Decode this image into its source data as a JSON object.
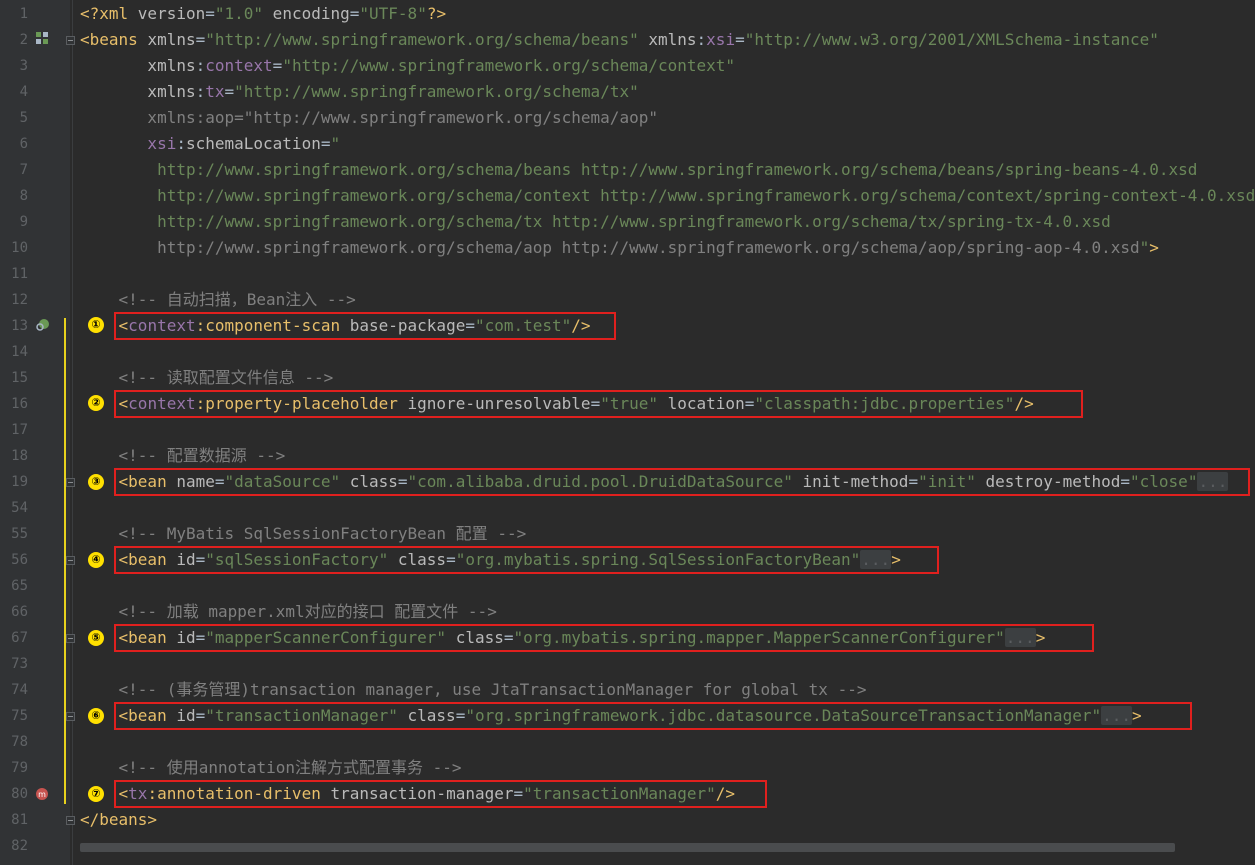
{
  "editor": {
    "lines": [
      {
        "n": "1",
        "parts": [
          [
            "tag",
            "<?xml "
          ],
          [
            "attr",
            "version"
          ],
          [
            "",
            "="
          ],
          [
            "val",
            "\"1.0\""
          ],
          [
            "attr",
            " encoding"
          ],
          [
            "",
            "="
          ],
          [
            "val",
            "\"UTF-8\""
          ],
          [
            "tag",
            "?>"
          ]
        ]
      },
      {
        "n": "2",
        "parts": [
          [
            "tag",
            "<beans "
          ],
          [
            "attr",
            "xmlns"
          ],
          [
            "",
            "="
          ],
          [
            "val",
            "\"http://www.springframework.org/schema/beans\""
          ],
          [
            "attr",
            " xmlns"
          ],
          [
            "",
            ":"
          ],
          [
            "ns",
            "xsi"
          ],
          [
            "",
            "="
          ],
          [
            "val",
            "\"http://www.w3.org/2001/XMLSchema-instance\""
          ]
        ]
      },
      {
        "n": "3",
        "parts": [
          [
            "attr",
            "       xmlns"
          ],
          [
            "",
            ":"
          ],
          [
            "ns",
            "context"
          ],
          [
            "",
            "="
          ],
          [
            "val",
            "\"http://www.springframework.org/schema/context\""
          ]
        ]
      },
      {
        "n": "4",
        "parts": [
          [
            "attr",
            "       xmlns"
          ],
          [
            "",
            ":"
          ],
          [
            "ns",
            "tx"
          ],
          [
            "",
            "="
          ],
          [
            "val",
            "\"http://www.springframework.org/schema/tx\""
          ]
        ]
      },
      {
        "n": "5",
        "parts": [
          [
            "cm",
            "       xmlns:aop=\"http://www.springframework.org/schema/aop\""
          ]
        ]
      },
      {
        "n": "6",
        "parts": [
          [
            "ns",
            "       xsi"
          ],
          [
            "",
            ":"
          ],
          [
            "attr",
            "schemaLocation"
          ],
          [
            "",
            "="
          ],
          [
            "val",
            "\""
          ]
        ]
      },
      {
        "n": "7",
        "parts": [
          [
            "val",
            "        http://www.springframework.org/schema/beans http://www.springframework.org/schema/beans/spring-beans-4.0.xsd"
          ]
        ]
      },
      {
        "n": "8",
        "parts": [
          [
            "val",
            "        http://www.springframework.org/schema/context http://www.springframework.org/schema/context/spring-context-4.0.xsd"
          ]
        ]
      },
      {
        "n": "9",
        "parts": [
          [
            "val",
            "        http://www.springframework.org/schema/tx http://www.springframework.org/schema/tx/spring-tx-4.0.xsd"
          ]
        ]
      },
      {
        "n": "10",
        "parts": [
          [
            "cm",
            "        http://www.springframework.org/schema/aop http://www.springframework.org/schema/aop/spring-aop-4.0.xsd"
          ],
          [
            "val",
            "\""
          ],
          [
            "tag",
            ">"
          ]
        ]
      },
      {
        "n": "11",
        "parts": []
      },
      {
        "n": "12",
        "parts": [
          [
            "cm",
            "    <!-- 自动扫描，Bean注入 -->"
          ]
        ]
      },
      {
        "n": "13",
        "parts": [
          [
            "tag",
            "    <"
          ],
          [
            "ns",
            "context"
          ],
          [
            "tag",
            ":component-scan "
          ],
          [
            "attr",
            "base-package"
          ],
          [
            "",
            "="
          ],
          [
            "val",
            "\"com.test\""
          ],
          [
            "tag",
            "/>"
          ]
        ]
      },
      {
        "n": "14",
        "parts": []
      },
      {
        "n": "15",
        "parts": [
          [
            "cm",
            "    <!-- 读取配置文件信息 -->"
          ]
        ]
      },
      {
        "n": "16",
        "parts": [
          [
            "tag",
            "    <"
          ],
          [
            "ns",
            "context"
          ],
          [
            "tag",
            ":property-placeholder "
          ],
          [
            "attr",
            "ignore-unresolvable"
          ],
          [
            "",
            "="
          ],
          [
            "val",
            "\"true\""
          ],
          [
            "attr",
            " location"
          ],
          [
            "",
            "="
          ],
          [
            "val",
            "\"classpath:jdbc.properties\""
          ],
          [
            "tag",
            "/>"
          ]
        ]
      },
      {
        "n": "17",
        "parts": []
      },
      {
        "n": "18",
        "parts": [
          [
            "cm",
            "    <!-- 配置数据源 -->"
          ]
        ]
      },
      {
        "n": "19",
        "parts": [
          [
            "tag",
            "    <bean "
          ],
          [
            "attr",
            "name"
          ],
          [
            "",
            "="
          ],
          [
            "val",
            "\"dataSource\""
          ],
          [
            "attr",
            " class"
          ],
          [
            "",
            "="
          ],
          [
            "val",
            "\"com.alibaba.druid.pool.DruidDataSource\""
          ],
          [
            "attr",
            " init-method"
          ],
          [
            "",
            "="
          ],
          [
            "val",
            "\"init\""
          ],
          [
            "attr",
            " destroy-method"
          ],
          [
            "",
            "="
          ],
          [
            "val",
            "\"close\""
          ],
          [
            "fold",
            "..."
          ]
        ]
      },
      {
        "n": "54",
        "parts": []
      },
      {
        "n": "55",
        "parts": [
          [
            "cm",
            "    <!-- MyBatis SqlSessionFactoryBean 配置 -->"
          ]
        ]
      },
      {
        "n": "56",
        "parts": [
          [
            "tag",
            "    <bean "
          ],
          [
            "attr",
            "id"
          ],
          [
            "",
            "="
          ],
          [
            "val",
            "\"sqlSessionFactory\""
          ],
          [
            "attr",
            " class"
          ],
          [
            "",
            "="
          ],
          [
            "val",
            "\"org.mybatis.spring.SqlSessionFactoryBean\""
          ],
          [
            "fold",
            "..."
          ],
          [
            "tag",
            ">"
          ]
        ]
      },
      {
        "n": "65",
        "parts": []
      },
      {
        "n": "66",
        "parts": [
          [
            "cm",
            "    <!-- 加载 mapper.xml对应的接口 配置文件 -->"
          ]
        ]
      },
      {
        "n": "67",
        "parts": [
          [
            "tag",
            "    <bean "
          ],
          [
            "attr",
            "id"
          ],
          [
            "",
            "="
          ],
          [
            "val",
            "\"mapperScannerConfigurer\""
          ],
          [
            "attr",
            " class"
          ],
          [
            "",
            "="
          ],
          [
            "val",
            "\"org.mybatis.spring.mapper.MapperScannerConfigurer\""
          ],
          [
            "fold",
            "..."
          ],
          [
            "tag",
            ">"
          ]
        ]
      },
      {
        "n": "73",
        "parts": []
      },
      {
        "n": "74",
        "parts": [
          [
            "cm",
            "    <!-- (事务管理)transaction manager, use JtaTransactionManager for global tx -->"
          ]
        ]
      },
      {
        "n": "75",
        "parts": [
          [
            "tag",
            "    <bean "
          ],
          [
            "attr",
            "id"
          ],
          [
            "",
            "="
          ],
          [
            "val",
            "\"transactionManager\""
          ],
          [
            "attr",
            " class"
          ],
          [
            "",
            "="
          ],
          [
            "val",
            "\"org.springframework.jdbc.datasource.DataSourceTransactionManager\""
          ],
          [
            "fold",
            "..."
          ],
          [
            "tag",
            ">"
          ]
        ]
      },
      {
        "n": "78",
        "parts": []
      },
      {
        "n": "79",
        "parts": [
          [
            "cm",
            "    <!-- 使用annotation注解方式配置事务 -->"
          ]
        ]
      },
      {
        "n": "80",
        "parts": [
          [
            "tag",
            "    <"
          ],
          [
            "ns",
            "tx"
          ],
          [
            "tag",
            ":annotation-driven "
          ],
          [
            "attr",
            "transaction-manager"
          ],
          [
            "",
            "="
          ],
          [
            "val",
            "\"transactionManager\""
          ],
          [
            "tag",
            "/>"
          ]
        ]
      },
      {
        "n": "81",
        "parts": [
          [
            "tag",
            "</beans>"
          ]
        ]
      },
      {
        "n": "82",
        "parts": []
      }
    ]
  },
  "markers": [
    "①",
    "②",
    "③",
    "④",
    "⑤",
    "⑥",
    "⑦"
  ]
}
